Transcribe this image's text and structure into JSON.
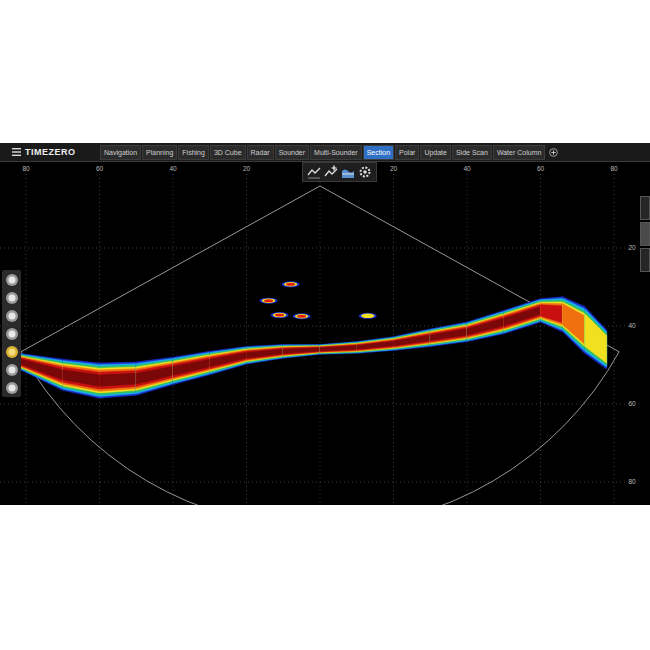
{
  "window": {
    "logo": "TIMEZERO"
  },
  "tabs": [
    {
      "label": "Navigation",
      "selected": false
    },
    {
      "label": "Planning",
      "selected": false
    },
    {
      "label": "Fishing",
      "selected": false
    },
    {
      "label": "3D Cube",
      "selected": false
    },
    {
      "label": "Radar",
      "selected": false
    },
    {
      "label": "Sounder",
      "selected": false
    },
    {
      "label": "Multi-Sounder",
      "selected": false
    },
    {
      "label": "Section",
      "selected": true
    },
    {
      "label": "Polar",
      "selected": false
    },
    {
      "label": "Update",
      "selected": false
    },
    {
      "label": "Side Scan",
      "selected": false
    },
    {
      "label": "Water Column",
      "selected": false
    }
  ],
  "left_tools": [
    {
      "selected": false
    },
    {
      "selected": false
    },
    {
      "selected": false
    },
    {
      "selected": false
    },
    {
      "selected": true
    },
    {
      "selected": false
    },
    {
      "selected": false
    }
  ],
  "side_tabs": [
    {
      "selected": false
    },
    {
      "selected": true
    },
    {
      "selected": false
    }
  ],
  "chart": {
    "x_ticks": [
      {
        "label": "80",
        "value": -80
      },
      {
        "label": "60",
        "value": -60
      },
      {
        "label": "40",
        "value": -40
      },
      {
        "label": "20",
        "value": -20
      },
      {
        "label": "20",
        "value": 20
      },
      {
        "label": "40",
        "value": 40
      },
      {
        "label": "60",
        "value": 60
      },
      {
        "label": "80",
        "value": 80
      }
    ],
    "depth_ticks": [
      {
        "label": "20",
        "value": 20
      },
      {
        "label": "40",
        "value": 40
      },
      {
        "label": "60",
        "value": 60
      },
      {
        "label": "80",
        "value": 80
      }
    ],
    "bottom": {
      "x": [
        -82,
        -70,
        -60,
        -50,
        -40,
        -30,
        -20,
        -10,
        0,
        10,
        20,
        30,
        40,
        50,
        60,
        66,
        72,
        78
      ],
      "depth": [
        49,
        52.5,
        54,
        53.5,
        51.5,
        49.5,
        47.5,
        46.5,
        46,
        45.5,
        44.5,
        43,
        41.5,
        39,
        36,
        37,
        41,
        46
      ],
      "thickness": [
        4,
        8,
        9,
        8.5,
        7,
        6,
        4.5,
        3.5,
        2.5,
        3,
        3.5,
        4.5,
        5,
        6,
        6,
        9,
        12,
        10
      ],
      "strength": [
        0.8,
        0.95,
        0.95,
        0.95,
        0.95,
        0.95,
        0.95,
        0.95,
        1,
        0.95,
        0.95,
        0.95,
        0.9,
        0.9,
        0.9,
        0.75,
        0.5,
        0.35
      ]
    },
    "targets": [
      {
        "x": -8,
        "depth": 29.3,
        "strength": 0.75
      },
      {
        "x": -14,
        "depth": 33.5,
        "strength": 0.6
      },
      {
        "x": -5,
        "depth": 37.5,
        "strength": 0.7
      },
      {
        "x": -11,
        "depth": 37.2,
        "strength": 0.55
      },
      {
        "x": 13,
        "depth": 37.4,
        "strength": 0.4
      }
    ]
  }
}
